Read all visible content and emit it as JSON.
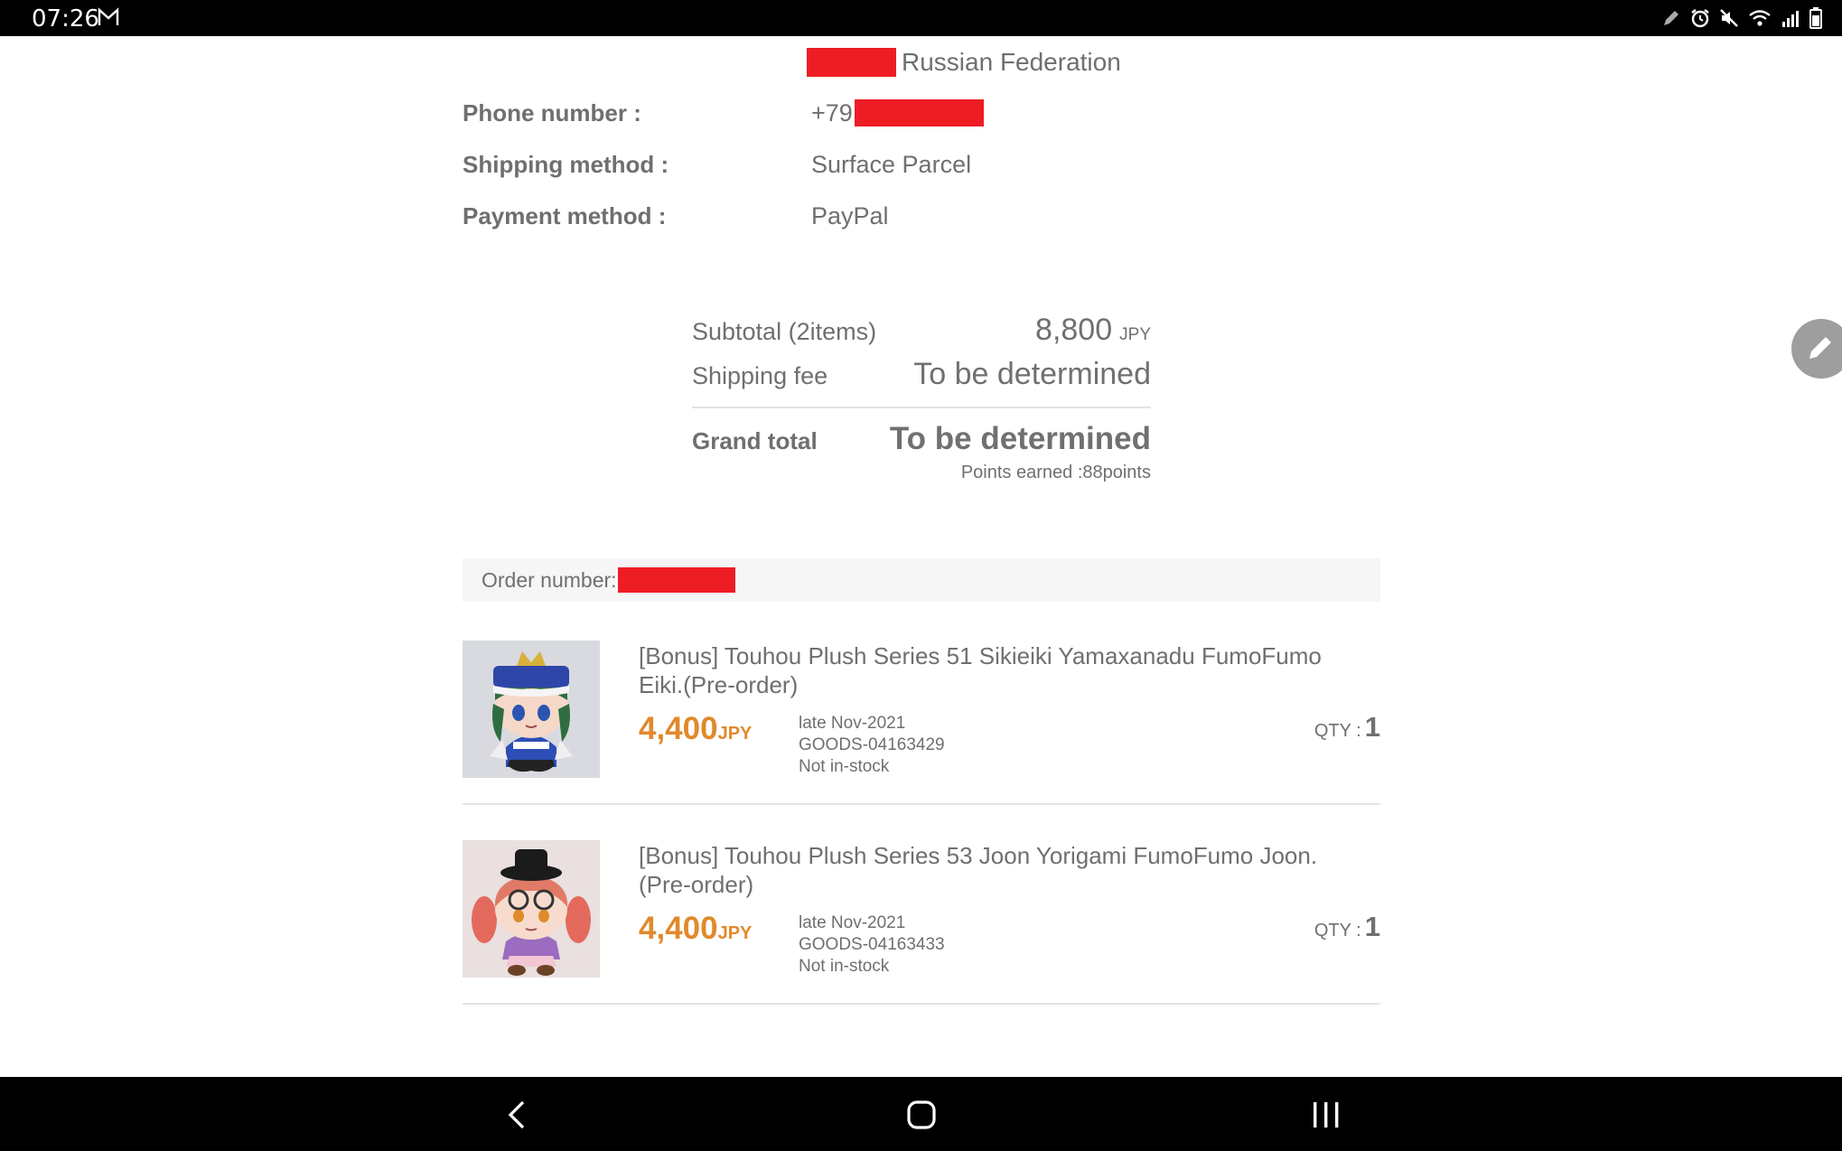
{
  "status_bar": {
    "time": "07:26"
  },
  "address": {
    "country": "Russian Federation"
  },
  "info": {
    "phone_label": "Phone number :",
    "phone_prefix": "+79",
    "shipping_label": "Shipping method :",
    "shipping_value": "Surface Parcel",
    "payment_label": "Payment method :",
    "payment_value": "PayPal"
  },
  "totals": {
    "subtotal_label": "Subtotal (2items)",
    "subtotal_value": "8,800",
    "subtotal_unit": "JPY",
    "shipping_label": "Shipping fee",
    "shipping_value": "To be determined",
    "grand_label": "Grand total",
    "grand_value": "To be determined",
    "points": "Points earned :88points"
  },
  "order": {
    "number_label": "Order number:"
  },
  "items": [
    {
      "title": "[Bonus] Touhou Plush Series 51 Sikieiki Yamaxanadu FumoFumo Eiki.(Pre-order)",
      "price": "4,400",
      "currency": "JPY",
      "release": "late Nov-2021",
      "code": "GOODS-04163429",
      "stock": "Not in-stock",
      "qty_label": "QTY :",
      "qty": "1"
    },
    {
      "title": "[Bonus] Touhou Plush Series 53 Joon Yorigami FumoFumo Joon.(Pre-order)",
      "price": "4,400",
      "currency": "JPY",
      "release": "late Nov-2021",
      "code": "GOODS-04163433",
      "stock": "Not in-stock",
      "qty_label": "QTY :",
      "qty": "1"
    }
  ],
  "colors": {
    "accent_price": "#e08a2b",
    "redaction": "#ee1c25"
  },
  "icons": [
    "mail-icon",
    "pen-icon",
    "alarm-icon",
    "mute-icon",
    "wifi-icon",
    "signal-icon",
    "battery-icon",
    "edit-icon",
    "back-icon",
    "home-icon",
    "recents-icon"
  ]
}
